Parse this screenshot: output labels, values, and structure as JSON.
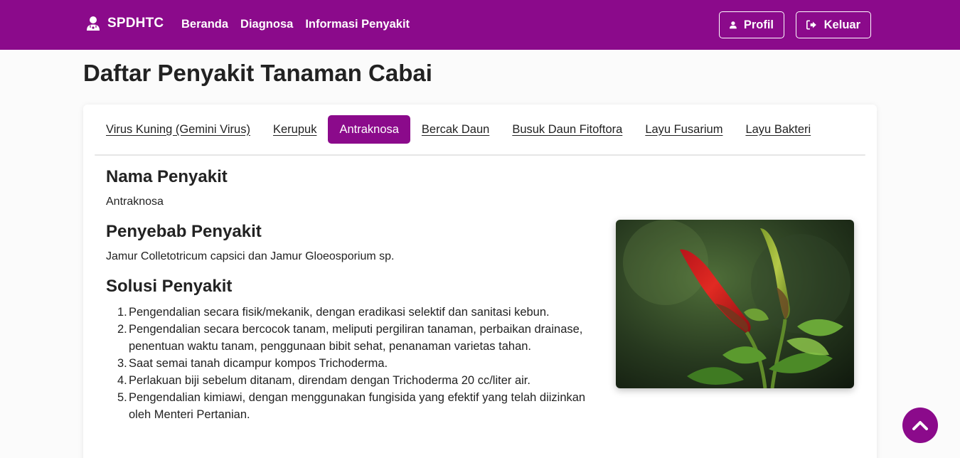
{
  "navbar": {
    "brand": "SPDHTC",
    "links": [
      "Beranda",
      "Diagnosa",
      "Informasi Penyakit"
    ],
    "profile_label": "Profil",
    "logout_label": "Keluar"
  },
  "page": {
    "title": "Daftar Penyakit Tanaman Cabai"
  },
  "tabs": [
    {
      "label": "Virus Kuning (Gemini Virus)",
      "active": false
    },
    {
      "label": "Kerupuk",
      "active": false
    },
    {
      "label": "Antraknosa",
      "active": true
    },
    {
      "label": "Bercak Daun",
      "active": false
    },
    {
      "label": "Busuk Daun Fitoftora",
      "active": false
    },
    {
      "label": "Layu Fusarium",
      "active": false
    },
    {
      "label": "Layu Bakteri",
      "active": false
    }
  ],
  "detail": {
    "name_heading": "Nama Penyakit",
    "name_value": "Antraknosa",
    "cause_heading": "Penyebab Penyakit",
    "cause_value": "Jamur Colletotricum capsici dan Jamur Gloeosporium sp.",
    "solution_heading": "Solusi Penyakit",
    "solutions": [
      "Pengendalian secara fisik/mekanik, dengan eradikasi selektif dan sanitasi kebun.",
      "Pengendalian secara bercocok tanam, meliputi pergiliran tanaman, perbaikan drainase, penentuan waktu tanam, penggunaan bibit sehat, penanaman varietas tahan.",
      "Saat semai tanah dicampur kompos Trichoderma.",
      "Perlakuan biji sebelum ditanam, direndam dengan Trichoderma 20 cc/liter air.",
      "Pengendalian kimiawi, dengan menggunakan fungisida yang efektif yang telah diizinkan oleh Menteri Pertanian."
    ]
  },
  "colors": {
    "primary": "#8b0a8b",
    "background": "#fbfbfb",
    "card": "#ffffff"
  },
  "icons": {
    "brand": "doctor-icon",
    "profile": "user-icon",
    "logout": "logout-icon",
    "scroll_top": "chevron-up-icon"
  }
}
